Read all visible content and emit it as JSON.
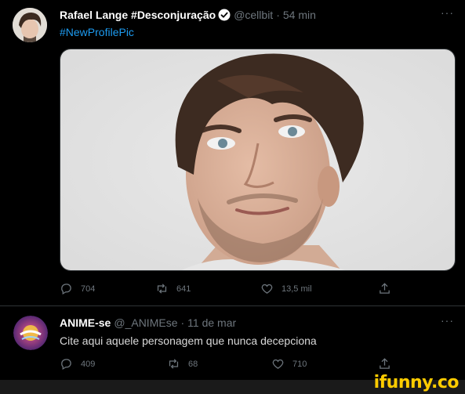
{
  "tweets": [
    {
      "name": "Rafael Lange #Desconjuração",
      "handle": "@cellbit",
      "separator": "·",
      "time": "54 min",
      "text": "#NewProfilePic",
      "verified": true,
      "counts": {
        "replies": "704",
        "retweets": "641",
        "likes": "13,5 mil"
      }
    },
    {
      "name": "ANIME-se",
      "handle": "@_ANIMEse",
      "separator": "·",
      "time": "11 de mar",
      "text": "Cite aqui aquele personagem que nunca decepciona",
      "verified": false,
      "counts": {
        "replies": "409",
        "retweets": "68",
        "likes": "710"
      }
    }
  ],
  "more_label": "···",
  "watermark": "ifunny.co",
  "colors": {
    "accent": "#1d9bf0",
    "secondary_text": "#6e767d",
    "background": "#000000",
    "watermark": "#ffcc00"
  },
  "icons": [
    "reply-icon",
    "retweet-icon",
    "like-icon",
    "share-icon",
    "verified-badge-icon"
  ]
}
